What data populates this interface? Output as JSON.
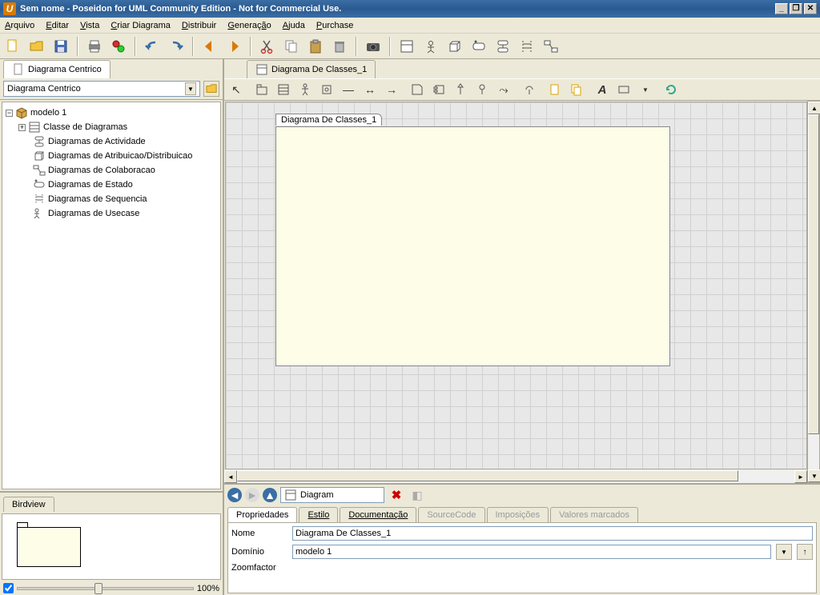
{
  "title": "Sem nome - Poseidon for UML Community Edition - Not for Commercial Use.",
  "menu": [
    "Arquivo",
    "Editar",
    "Vista",
    "Criar Diagrama",
    "Distribuir",
    "Generação",
    "Ajuda",
    "Purchase"
  ],
  "left_tab": "Diagrama Centrico",
  "selector_value": "Diagrama Centrico",
  "tree": {
    "root": "modelo 1",
    "class_group": "Classe de Diagramas",
    "children": [
      "Diagramas de Actividade",
      "Diagramas de Atribuicao/Distribuicao",
      "Diagramas de Colaboracao",
      "Diagramas de Estado",
      "Diagramas de Sequencia",
      "Diagramas de Usecase"
    ]
  },
  "birdview_label": "Birdview",
  "zoom_label": "100%",
  "diagram_tab": "Diagrama De Classes_1",
  "diagram_label": "Diagrama De Classes_1",
  "nav_combo": "Diagram",
  "prop_tabs": {
    "active": "Propriedades",
    "others": [
      "Estilo",
      "Documentação"
    ],
    "disabled": [
      "SourceCode",
      "Imposições",
      "Valores marcados"
    ]
  },
  "props": {
    "nome_label": "Nome",
    "nome_value": "Diagrama De Classes_1",
    "dominio_label": "Domínio",
    "dominio_value": "modelo 1",
    "zoom_label": "Zoomfactor"
  },
  "colors": {
    "accent": "#3a6ea5",
    "canvas_bg": "#fdfde8"
  }
}
